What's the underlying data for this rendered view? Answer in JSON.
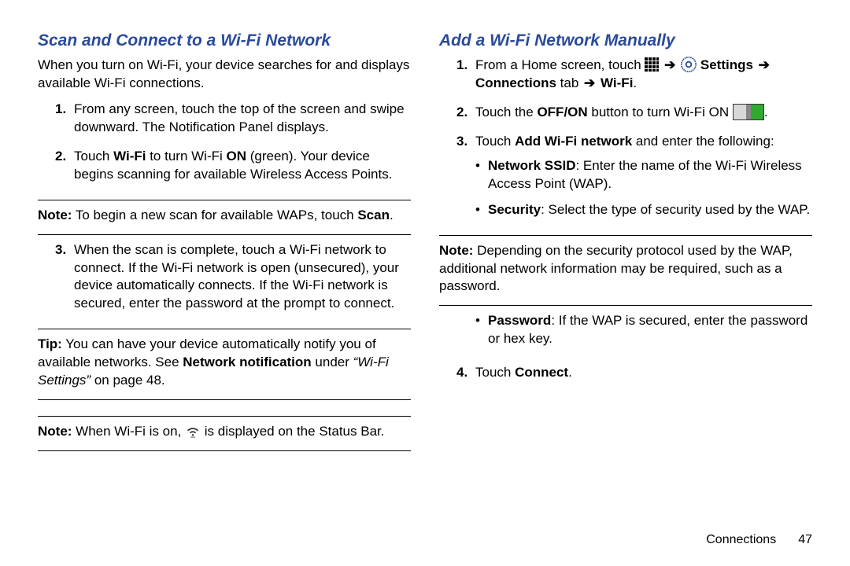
{
  "left": {
    "heading": "Scan and Connect to a Wi-Fi Network",
    "intro": "When you turn on Wi-Fi, your device searches for and displays available Wi-Fi connections.",
    "step1": "From any screen, touch the top of the screen and swipe downward. The Notification Panel displays.",
    "step2_a": "Touch ",
    "step2_b": "Wi-Fi",
    "step2_c": " to turn Wi-Fi ",
    "step2_d": "ON",
    "step2_e": " (green). Your device begins scanning for available Wireless Access Points.",
    "note1_a": "Note:",
    "note1_b": " To begin a new scan for available WAPs, touch ",
    "note1_c": "Scan",
    "note1_d": ".",
    "step3": "When the scan is complete, touch a Wi-Fi network to connect. If the Wi-Fi network is open (unsecured), your device automatically connects. If the Wi-Fi network is secured, enter the password at the prompt to connect.",
    "tip_a": "Tip:",
    "tip_b": " You can have your device automatically notify you of available networks. See ",
    "tip_c": "Network notification",
    "tip_d": " under ",
    "tip_e": "“Wi-Fi Settings”",
    "tip_f": " on page 48.",
    "note2_a": "Note:",
    "note2_b": " When Wi-Fi is on, ",
    "note2_c": " is displayed on the Status Bar."
  },
  "right": {
    "heading": "Add a Wi-Fi Network Manually",
    "step1_a": "From a Home screen, touch ",
    "step1_b": "Settings",
    "step1_c": "Connections",
    "step1_d": " tab ",
    "step1_e": "Wi-Fi",
    "step1_end": ".",
    "step2_a": "Touch the ",
    "step2_b": "OFF/ON",
    "step2_c": " button to turn Wi-Fi ON ",
    "step2_end": ".",
    "step3_a": "Touch ",
    "step3_b": "Add Wi-Fi network",
    "step3_c": " and enter the following:",
    "b1_a": "Network SSID",
    "b1_b": ": Enter the name of the Wi-Fi Wireless Access Point (WAP).",
    "b2_a": "Security",
    "b2_b": ": Select the type of security used by the WAP.",
    "note_a": "Note:",
    "note_b": " Depending on the security protocol used by the WAP, additional network information may be required, such as a password.",
    "b3_a": "Password",
    "b3_b": ": If the WAP is secured, enter the password or hex key.",
    "step4_a": "Touch ",
    "step4_b": "Connect",
    "step4_c": "."
  },
  "footer": {
    "section": "Connections",
    "page": "47"
  }
}
